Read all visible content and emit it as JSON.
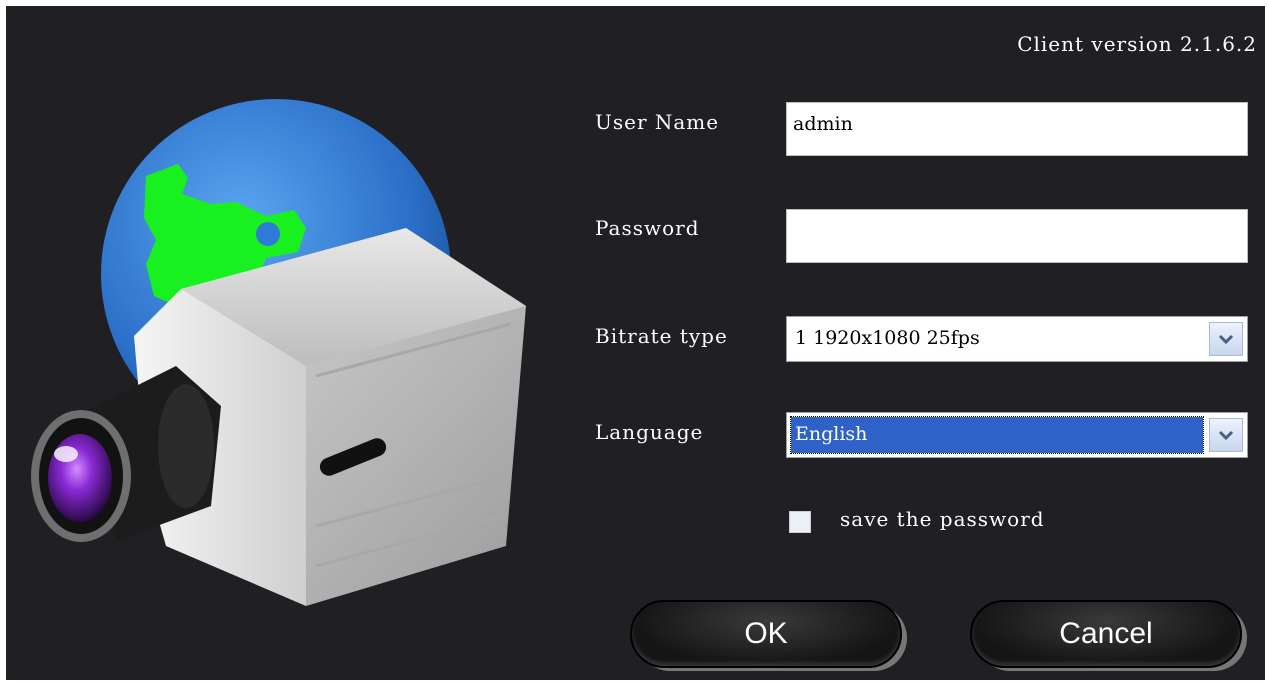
{
  "window": {
    "version": "Client version 2.1.6.2"
  },
  "form": {
    "username_label": "User Name",
    "username_value": "admin",
    "password_label": "Password",
    "password_value": "",
    "bitrate_label": "Bitrate type",
    "bitrate_value": "1 1920x1080 25fps",
    "language_label": "Language",
    "language_value": "English",
    "save_password_label": "save the password",
    "save_password_checked": false
  },
  "buttons": {
    "ok": "OK",
    "cancel": "Cancel"
  },
  "icons": {
    "logo": "camera-globe-icon",
    "dropdown": "chevron-down-icon",
    "checkbox": "checkbox-icon"
  },
  "colors": {
    "background": "#1f1f24",
    "selection": "#2e62c9",
    "globe": "#2f7ad6",
    "land": "#18f020"
  }
}
